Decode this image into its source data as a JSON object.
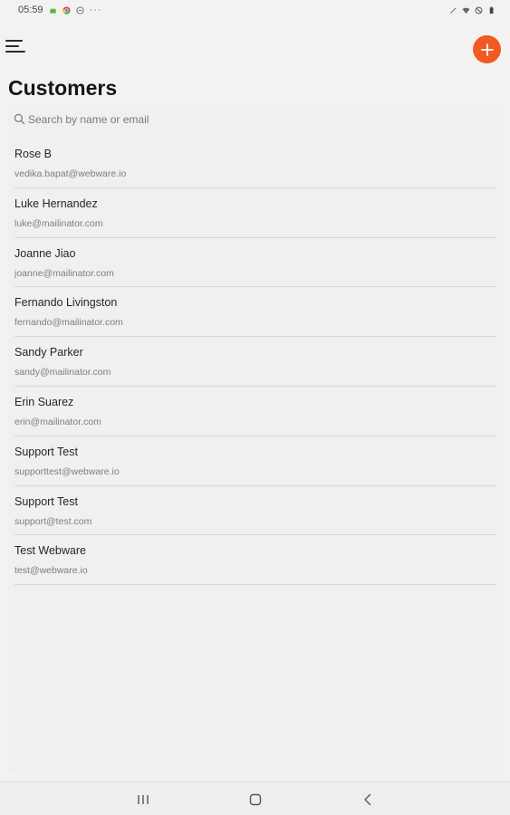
{
  "status_bar": {
    "time": "05:59",
    "overflow_dots": "···"
  },
  "header": {
    "title": "Customers",
    "menu_icon": "hamburger-menu-icon",
    "add_icon": "plus-icon",
    "accent_color": "#f15a22"
  },
  "search": {
    "placeholder": "Search by name or email",
    "value": ""
  },
  "customers": [
    {
      "name": "Rose B",
      "email": "vedika.bapat@webware.io"
    },
    {
      "name": "Luke Hernandez",
      "email": "luke@mailinator.com"
    },
    {
      "name": "Joanne Jiao",
      "email": "joanne@mailinator.com"
    },
    {
      "name": "Fernando Livingston",
      "email": "fernando@mailinator.com"
    },
    {
      "name": "Sandy Parker",
      "email": "sandy@mailinator.com"
    },
    {
      "name": "Erin Suarez",
      "email": "erin@mailinator.com"
    },
    {
      "name": "Support Test",
      "email": "supporttest@webware.io"
    },
    {
      "name": "Support Test",
      "email": "support@test.com"
    },
    {
      "name": "Test Webware",
      "email": "test@webware.io"
    }
  ],
  "nav_bar": {
    "recents_icon": "recent-apps-icon",
    "home_icon": "home-icon",
    "back_icon": "back-icon"
  }
}
